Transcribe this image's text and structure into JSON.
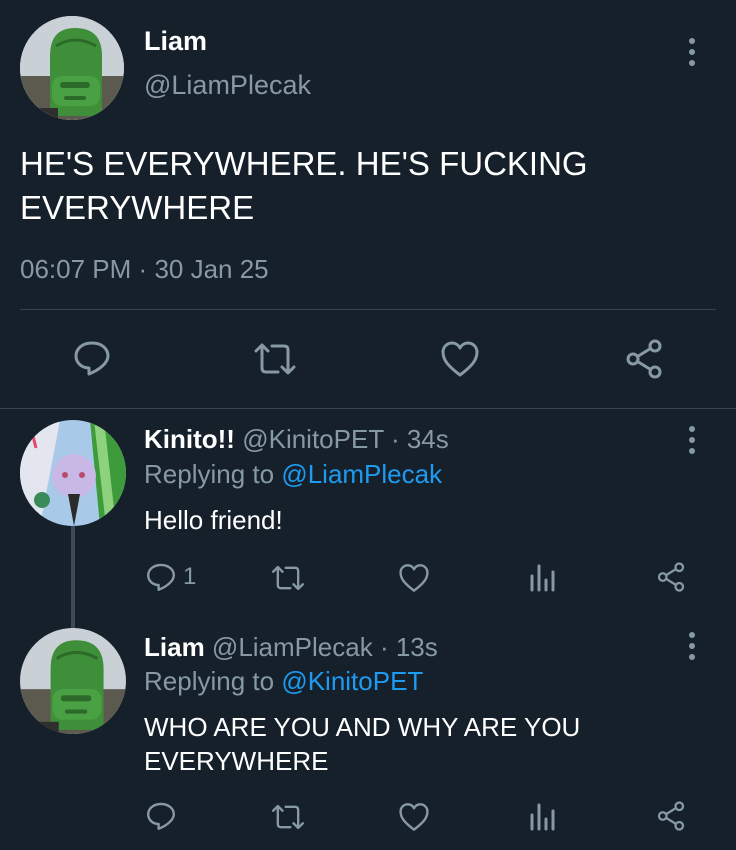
{
  "main_tweet": {
    "name": "Liam",
    "handle": "@LiamPlecak",
    "text_line1": "HE'S EVERYWHERE. HE'S FUCKING",
    "text_line2": "EVERYWHERE",
    "time": "06:07 PM",
    "separator": "·",
    "date": "30 Jan 25"
  },
  "reply1": {
    "name": "Kinito!!",
    "handle": "@KinitoPET",
    "age": "· 34s",
    "replying_prefix": "Replying to",
    "replying_handle": "@LiamPlecak",
    "text": "Hello friend!",
    "reply_count": "1"
  },
  "reply2": {
    "name": "Liam",
    "handle": "@LiamPlecak",
    "age": "· 13s",
    "replying_prefix": "Replying to",
    "replying_handle": "@KinitoPET",
    "text_line1": "WHO ARE YOU AND WHY ARE YOU",
    "text_line2": "EVERYWHERE"
  },
  "icons": {
    "reply": "reply-icon",
    "retweet": "retweet-icon",
    "like": "heart-icon",
    "share": "share-icon",
    "analytics": "analytics-icon",
    "more": "more-options-icon"
  },
  "colors": {
    "background": "#15202b",
    "muted": "#8899a6",
    "link": "#1d9bf0",
    "divider": "#38444d"
  }
}
